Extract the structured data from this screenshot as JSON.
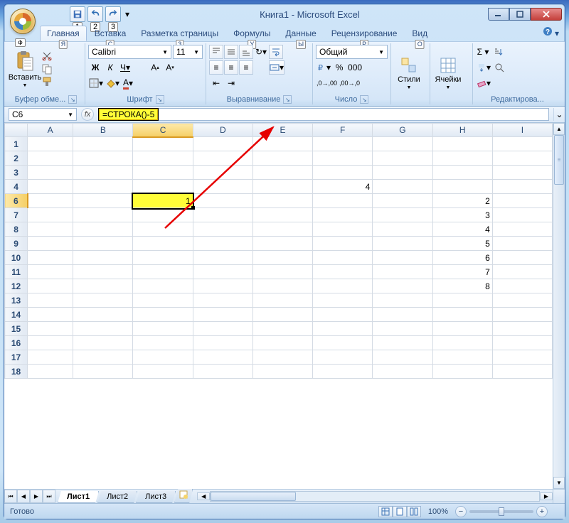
{
  "titlebar": {
    "document": "Книга1",
    "app": "Microsoft Excel",
    "qat_keys": [
      "1",
      "2",
      "3"
    ]
  },
  "hotkeys": {
    "office": "Ф"
  },
  "tabs": {
    "items": [
      {
        "label": "Главная",
        "key": "Я"
      },
      {
        "label": "Вставка",
        "key": "С"
      },
      {
        "label": "Разметка страницы",
        "key": "З"
      },
      {
        "label": "Формулы",
        "key": "У"
      },
      {
        "label": "Данные",
        "key": "Ы"
      },
      {
        "label": "Рецензирование",
        "key": "Р"
      },
      {
        "label": "Вид",
        "key": "О"
      }
    ]
  },
  "ribbon": {
    "clipboard": {
      "paste": "Вставить",
      "label": "Буфер обме..."
    },
    "font": {
      "name": "Calibri",
      "size": "11",
      "label": "Шрифт",
      "bold": "Ж",
      "italic": "К",
      "underline": "Ч"
    },
    "align": {
      "label": "Выравнивание"
    },
    "number": {
      "format": "Общий",
      "label": "Число"
    },
    "styles": {
      "label": "Стили"
    },
    "cells": {
      "label": "Ячейки"
    },
    "editing": {
      "label": "Редактирова..."
    }
  },
  "formulabar": {
    "cell_ref": "C6",
    "formula": "=СТРОКА()-5"
  },
  "grid": {
    "columns": [
      "A",
      "B",
      "C",
      "D",
      "E",
      "F",
      "G",
      "H",
      "I"
    ],
    "selected_col_idx": 2,
    "first_rows": [
      1,
      2,
      3,
      4,
      6,
      7,
      8,
      9,
      10,
      11,
      12,
      13,
      14,
      15,
      16,
      17,
      18
    ],
    "selected_row": 6,
    "cells": {
      "F4": "4",
      "C6": "1",
      "H6": "2",
      "H7": "3",
      "H8": "4",
      "H9": "5",
      "H10": "6",
      "H11": "7",
      "H12": "8"
    }
  },
  "sheets": {
    "items": [
      "Лист1",
      "Лист2",
      "Лист3"
    ],
    "active": 0
  },
  "statusbar": {
    "status": "Готово",
    "zoom": "100%"
  }
}
